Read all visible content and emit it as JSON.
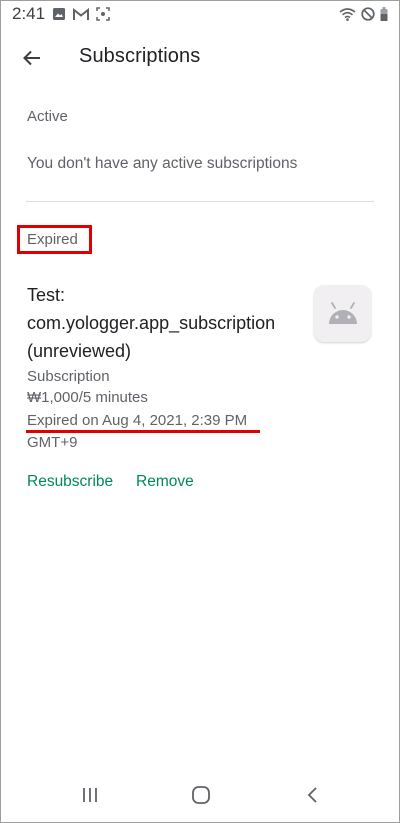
{
  "status_bar": {
    "time": "2:41",
    "left_icons": [
      "image-icon",
      "gmail-icon",
      "screenshot-icon"
    ],
    "right_icons": [
      "wifi-icon",
      "do-not-disturb-icon",
      "battery-icon"
    ]
  },
  "app_bar": {
    "back_icon": "arrow-left-icon",
    "title": "Subscriptions"
  },
  "active_section": {
    "label": "Active",
    "empty_message": "You don't have any active subscriptions"
  },
  "expired_section": {
    "label": "Expired",
    "item": {
      "name_line1": "Test:",
      "name_line2": "com.yologger.app_subscription",
      "name_line3": "(unreviewed)",
      "app_icon": "android-icon",
      "type": "Subscription",
      "price": "₩1,000/5 minutes",
      "expired_on": "Expired on Aug 4, 2021, 2:39 PM",
      "timezone": "GMT+9",
      "resubscribe_label": "Resubscribe",
      "remove_label": "Remove"
    }
  },
  "nav_bar": {
    "icons": [
      "recents-icon",
      "home-icon",
      "back-icon"
    ]
  },
  "colors": {
    "accent": "#01875f",
    "highlight": "#e00000",
    "secondary_text": "#5f6368",
    "primary_text": "#202124"
  }
}
